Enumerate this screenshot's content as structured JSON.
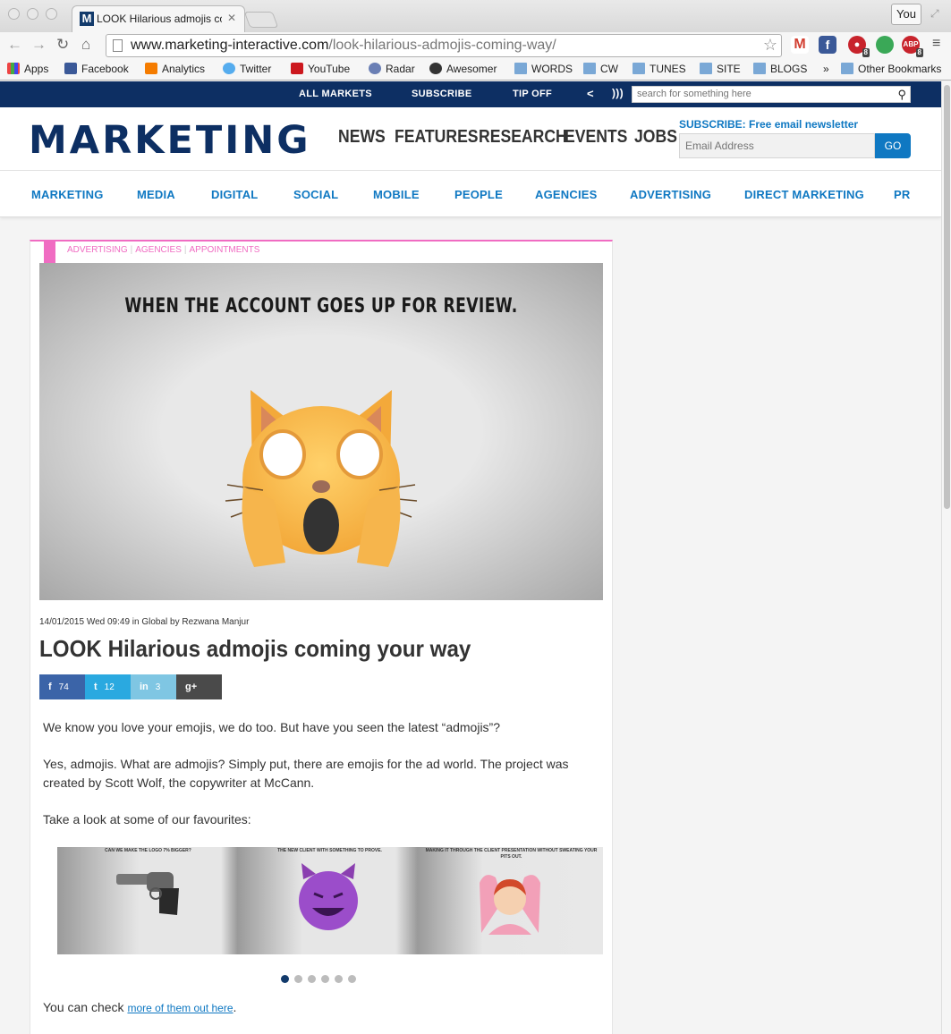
{
  "browser": {
    "tab_title": "LOOK Hilarious admojis co",
    "tab_favicon": "M",
    "profile": "You",
    "url_domain": "www.marketing-interactive.com",
    "url_path": "/look-hilarious-admojis-coming-way/",
    "bookmarks": [
      "Apps",
      "Facebook",
      "Analytics",
      "Twitter",
      "YouTube",
      "Radar",
      "Awesomer",
      "WORDS",
      "CW",
      "TUNES",
      "SITE",
      "BLOGS",
      "»",
      "Other Bookmarks"
    ],
    "extensions": [
      {
        "name": "gmail-icon",
        "color": "#d23f31",
        "label": "M"
      },
      {
        "name": "facebook-ext-icon",
        "color": "#3b5998",
        "label": "f"
      },
      {
        "name": "notification-ext-icon",
        "color": "#c8232c",
        "label": "●",
        "badge": "8"
      },
      {
        "name": "evernote-ext-icon",
        "color": "#3aa857",
        "label": "●"
      },
      {
        "name": "adblock-plus-icon",
        "color": "#c8232c",
        "label": "ABP",
        "badge": "8"
      }
    ]
  },
  "site": {
    "topbar": {
      "links": [
        "ALL MARKETS",
        "SUBSCRIBE",
        "TIP OFF"
      ],
      "search_placeholder": "search for something here"
    },
    "logo": "MARKETING",
    "main_nav": [
      "NEWS",
      "FEATURES",
      "RESEARCH",
      "EVENTS",
      "JOBS"
    ],
    "newsletter": {
      "label": "SUBSCRIBE: Free email newsletter",
      "placeholder": "Email Address",
      "button": "GO"
    },
    "categories": [
      "MARKETING",
      "MEDIA",
      "DIGITAL",
      "SOCIAL",
      "MOBILE",
      "PEOPLE",
      "AGENCIES",
      "ADVERTISING",
      "DIRECT MARKETING",
      "PR"
    ]
  },
  "article": {
    "tags": [
      "ADVERTISING",
      "AGENCIES",
      "APPOINTMENTS"
    ],
    "hero_caption": "WHEN THE ACCOUNT GOES UP FOR REVIEW.",
    "meta": "14/01/2015 Wed 09:49 in Global by Rezwana Manjur",
    "title": "LOOK Hilarious admojis coming your way",
    "shares": [
      {
        "network": "facebook",
        "glyph": "f",
        "count": "74",
        "color": "#3b64a8"
      },
      {
        "network": "twitter",
        "glyph": "t",
        "count": "12",
        "color": "#2aa9e0"
      },
      {
        "network": "linkedin",
        "glyph": "in",
        "count": "3",
        "color": "#7fc6e3"
      },
      {
        "network": "googleplus",
        "glyph": "g+",
        "count": "",
        "color": "#4a4a4a"
      }
    ],
    "paragraphs": [
      "We know you love your emojis, we do too. But have you seen the latest “admojis”?",
      "Yes, admojis. What are admojis? Simply put, there are emojis for the ad world. The project was created by Scott Wolf, the copywriter at McCann.",
      "Take a look at some of our favourites:"
    ],
    "gallery": {
      "captions": [
        "CAN WE MAKE THE LOGO 7% BIGGER?",
        "THE NEW CLIENT WITH SOMETHING TO PROVE.",
        "MAKING IT THROUGH THE CLIENT PRESENTATION WITHOUT SWEATING YOUR PITS OUT."
      ],
      "dots": 6,
      "active_dot": 0
    },
    "closing_text": "You can check ",
    "closing_link": "more of them out here",
    "closing_end": "."
  }
}
